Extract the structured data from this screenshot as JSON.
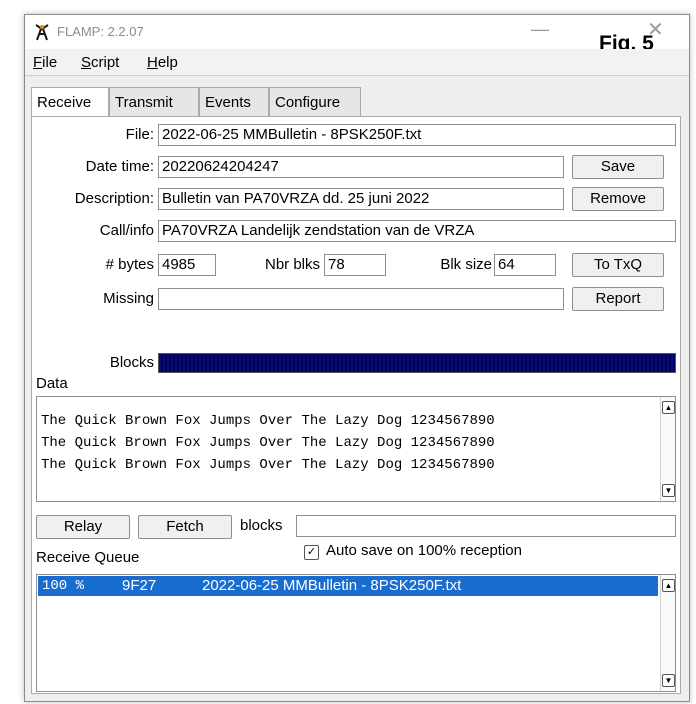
{
  "window": {
    "title": "FLAMP: 2.2.07",
    "minimize_glyph": "—",
    "close_glyph": "✕",
    "fig_label": "Fig. 5"
  },
  "menu": [
    "File",
    "Script",
    "Help"
  ],
  "tabs": [
    {
      "label": "Receive",
      "active": true
    },
    {
      "label": "Transmit",
      "active": false
    },
    {
      "label": "Events",
      "active": false
    },
    {
      "label": "Configure",
      "active": false
    }
  ],
  "receive": {
    "file_label": "File:",
    "file_value": "2022-06-25 MMBulletin - 8PSK250F.txt",
    "datetime_label": "Date time:",
    "datetime_value": "20220624204247",
    "description_label": "Description:",
    "description_value": "Bulletin van PA70VRZA dd. 25 juni 2022",
    "callinfo_label": "Call/info",
    "callinfo_value": "PA70VRZA Landelijk zendstation van de VRZA",
    "bytes_label": "# bytes",
    "bytes_value": "4985",
    "nbr_blks_label": "Nbr blks",
    "nbr_blks_value": "78",
    "blk_size_label": "Blk size",
    "blk_size_value": "64",
    "missing_label": "Missing",
    "missing_value": "",
    "blocks_label": "Blocks",
    "blocks_progress": 1.0,
    "buttons": {
      "save": "Save",
      "remove": "Remove",
      "to_txq": "To TxQ",
      "report": "Report"
    },
    "data_label": "Data",
    "data_lines": [
      "The Quick Brown Fox Jumps Over The Lazy Dog 1234567890",
      "The Quick Brown Fox Jumps Over The Lazy Dog 1234567890",
      "The Quick Brown Fox Jumps Over The Lazy Dog 1234567890"
    ],
    "relay_button": "Relay",
    "fetch_button": "Fetch",
    "blocks_field_label": "blocks",
    "blocks_field_value": "",
    "autosave_label": "Auto save on 100% reception",
    "autosave_checked": true,
    "queue_label": "Receive Queue",
    "queue_rows": [
      {
        "pct": "100 %",
        "id": "9F27",
        "file": "2022-06-25 MMBulletin - 8PSK250F.txt",
        "selected": true
      }
    ]
  },
  "colors": {
    "selection": "#1a6dd0",
    "blocks_fill": "#000066"
  },
  "icons": {
    "app": "antenna-tower-icon",
    "scroll_up": "chevron-up-icon",
    "scroll_down": "chevron-down-icon"
  }
}
